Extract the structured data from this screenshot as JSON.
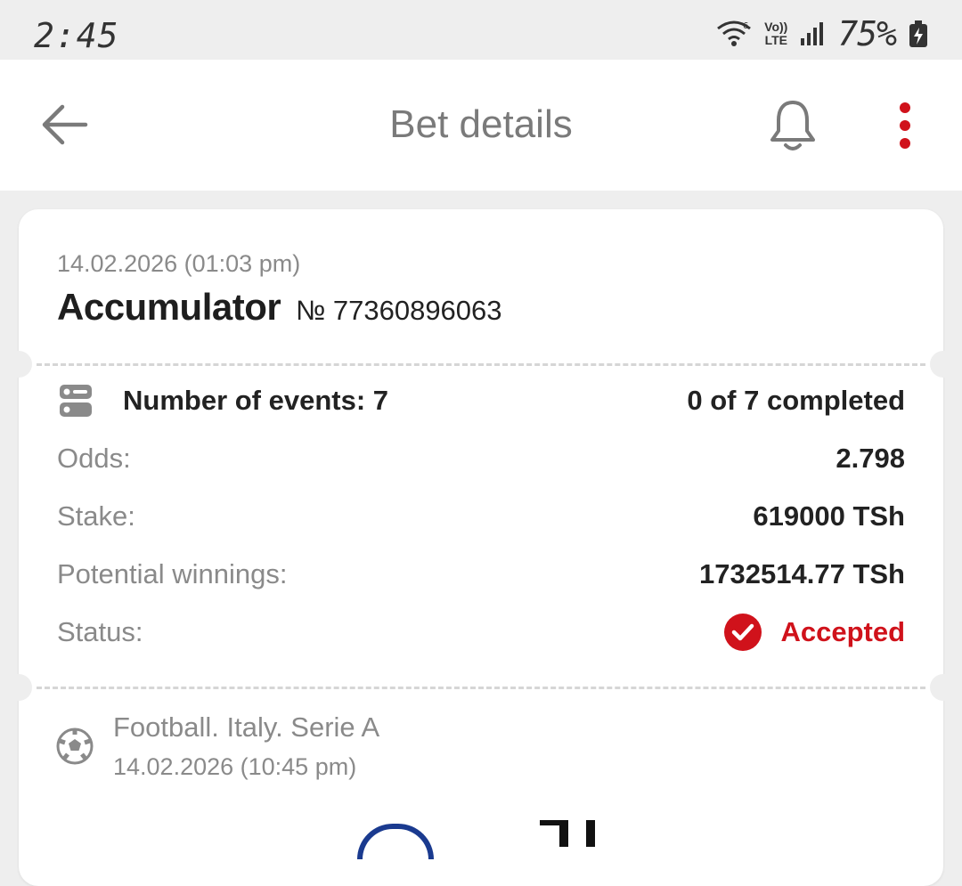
{
  "status_bar": {
    "time": "2:45",
    "wifi_icon": "wifi-icon",
    "lte_top": "Vo))",
    "lte_bottom": "LTE",
    "signal_icon": "signal-bars-icon",
    "battery_percent": "75%",
    "battery_icon": "battery-charging-icon"
  },
  "app_bar": {
    "back_icon": "arrow-left-icon",
    "title": "Bet details",
    "bell_icon": "bell-icon",
    "menu_icon": "more-vertical-icon"
  },
  "bet": {
    "date": "14.02.2026 (01:03 pm)",
    "type": "Accumulator",
    "number": "№ 77360896063",
    "events_label": "Number of events: 7",
    "events_completed": "0 of 7 completed",
    "rows": {
      "odds_label": "Odds:",
      "odds_value": "2.798",
      "stake_label": "Stake:",
      "stake_value": "619000 TSh",
      "winnings_label": "Potential winnings:",
      "winnings_value": "1732514.77 TSh",
      "status_label": "Status:",
      "status_value": "Accepted"
    }
  },
  "event": {
    "sport_icon": "football-icon",
    "league": "Football. Italy. Serie A",
    "date": "14.02.2026 (10:45 pm)"
  },
  "colors": {
    "accent_red": "#d0121b",
    "menu_dots": "#d0121b",
    "background": "#eeeeee",
    "card": "#ffffff"
  }
}
